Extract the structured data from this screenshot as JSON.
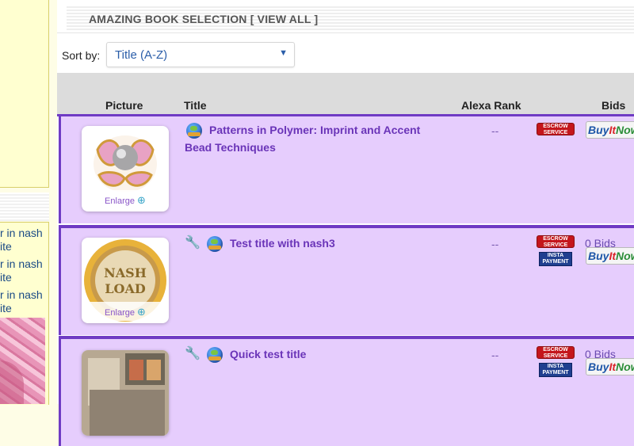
{
  "sidebar": {
    "links": [
      "r in nash",
      "ite",
      "r in nash",
      "ite",
      "r in nash",
      "ite"
    ]
  },
  "heading": {
    "text": "AMAZING BOOK SELECTION [ VIEW ALL ]"
  },
  "sort": {
    "label": "Sort by:",
    "value": "Title (A-Z)",
    "arrow": "▼"
  },
  "columns": {
    "picture": "Picture",
    "title": "Title",
    "alexa": "Alexa Rank",
    "bids": "Bids"
  },
  "listings": [
    {
      "title_line1": "Patterns in Polymer: Imprint and Accent",
      "title_line2": "Bead Techniques",
      "rank": "--",
      "bids": "",
      "enlarge": "Enlarge",
      "badges": {
        "escrow": "ESCROW SERVICE",
        "insta": "",
        "buy": [
          "Buy",
          "It",
          "Now"
        ]
      }
    },
    {
      "title_line1": "Test title with nash3",
      "title_line2": "",
      "rank": "--",
      "bids": "0 Bids",
      "enlarge": "Enlarge",
      "thumb_text": [
        "NASH",
        "LOAD"
      ],
      "badges": {
        "escrow": "ESCROW SERVICE",
        "insta": "INSTA PAYMENT",
        "buy": [
          "Buy",
          "It",
          "Now"
        ]
      }
    },
    {
      "title_line1": "Quick test title",
      "title_line2": "",
      "rank": "--",
      "bids": "0 Bids",
      "enlarge": "",
      "badges": {
        "escrow": "ESCROW SERVICE",
        "insta": "INSTA PAYMENT",
        "buy": [
          "Buy",
          "It",
          "Now"
        ]
      }
    }
  ],
  "colors": {
    "row_bg": "#e6cdfd",
    "row_border": "#6f3bc4",
    "link": "#6a34b8",
    "sidebar_bg": "#ffffd0"
  }
}
